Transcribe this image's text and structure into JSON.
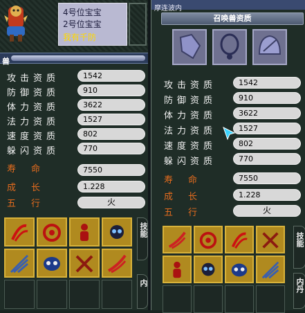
{
  "left_window": {
    "name_lines": [
      "4号位宝宝",
      "2号位宝宝",
      "我有千防"
    ],
    "header_tab": "兽",
    "stats": [
      {
        "label": "攻击资质",
        "value": "1542"
      },
      {
        "label": "防御资质",
        "value": "910"
      },
      {
        "label": "体力资质",
        "value": "3622"
      },
      {
        "label": "法力资质",
        "value": "1527"
      },
      {
        "label": "速度资质",
        "value": "802"
      },
      {
        "label": "躲闪资质",
        "value": "770"
      }
    ],
    "extra": [
      {
        "label": "寿命",
        "value": "7550"
      },
      {
        "label": "成长",
        "value": "1.228"
      },
      {
        "label": "五行",
        "value": "火"
      }
    ],
    "side_tabs": [
      {
        "label": "技能"
      },
      {
        "label": "内"
      }
    ]
  },
  "right_window": {
    "caption": "摩连波内",
    "title": "召唤兽资质",
    "stats": [
      {
        "label": "攻击资质",
        "value": "1542"
      },
      {
        "label": "防御资质",
        "value": "910"
      },
      {
        "label": "体力资质",
        "value": "3622"
      },
      {
        "label": "法力资质",
        "value": "1527"
      },
      {
        "label": "速度资质",
        "value": "802"
      },
      {
        "label": "躲闪资质",
        "value": "770"
      }
    ],
    "extra": [
      {
        "label": "寿命",
        "value": "7550"
      },
      {
        "label": "成长",
        "value": "1.228"
      },
      {
        "label": "五行",
        "value": "火"
      }
    ],
    "side_tabs": [
      {
        "label": "技能"
      },
      {
        "label": "内丹"
      }
    ]
  },
  "colors": {
    "accent_orange": "#e26b1e",
    "gold": "#b08a1f",
    "panel": "#213129"
  }
}
